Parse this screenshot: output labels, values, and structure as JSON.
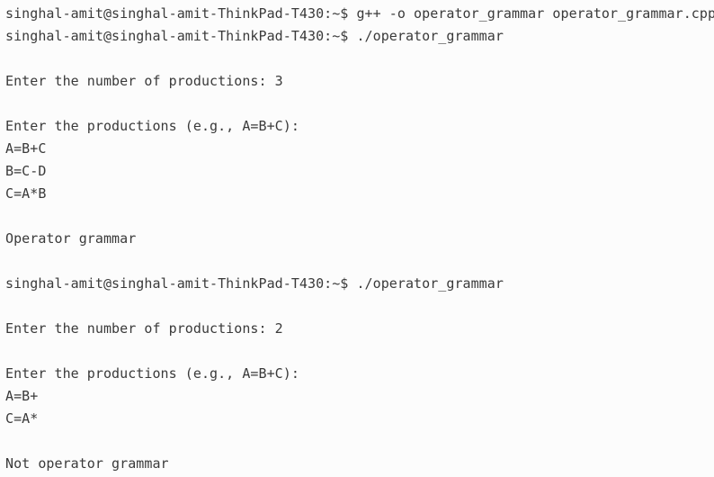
{
  "terminal": {
    "lines": [
      "singhal-amit@singhal-amit-ThinkPad-T430:~$ g++ -o operator_grammar operator_grammar.cpp",
      "singhal-amit@singhal-amit-ThinkPad-T430:~$ ./operator_grammar",
      "",
      "Enter the number of productions: 3",
      "",
      "Enter the productions (e.g., A=B+C):",
      "A=B+C",
      "B=C-D",
      "C=A*B",
      "",
      "Operator grammar",
      "",
      "singhal-amit@singhal-amit-ThinkPad-T430:~$ ./operator_grammar",
      "",
      "Enter the number of productions: 2",
      "",
      "Enter the productions (e.g., A=B+C):",
      "A=B+",
      "C=A*",
      "",
      "Not operator grammar"
    ]
  }
}
